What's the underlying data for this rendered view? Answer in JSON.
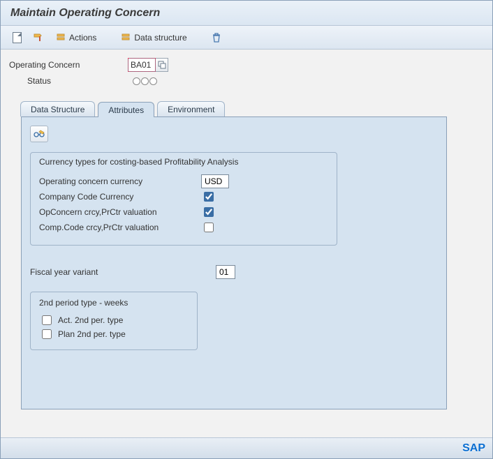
{
  "title": "Maintain Operating Concern",
  "toolbar": {
    "actions_label": "Actions",
    "data_structure_label": "Data structure"
  },
  "header": {
    "operating_concern_label": "Operating Concern",
    "operating_concern_value": "BA01",
    "status_label": "Status"
  },
  "tabs": {
    "data_structure": "Data Structure",
    "attributes": "Attributes",
    "environment": "Environment"
  },
  "attributes": {
    "currency_group_title": "Currency types for costing-based Profitability Analysis",
    "op_concern_currency_label": "Operating concern currency",
    "op_concern_currency_value": "USD",
    "company_code_currency_label": "Company Code Currency",
    "company_code_currency_checked": true,
    "opconcern_prctr_label": "OpConcern crcy,PrCtr valuation",
    "opconcern_prctr_checked": true,
    "compcode_prctr_label": "Comp.Code crcy,PrCtr valuation",
    "compcode_prctr_checked": false,
    "fiscal_year_variant_label": "Fiscal year variant",
    "fiscal_year_variant_value": "01",
    "period_group_title": "2nd period type - weeks",
    "act_2nd_label": "Act. 2nd per. type",
    "act_2nd_checked": false,
    "plan_2nd_label": "Plan 2nd per. type",
    "plan_2nd_checked": false
  },
  "footer": {
    "logo": "SAP"
  }
}
